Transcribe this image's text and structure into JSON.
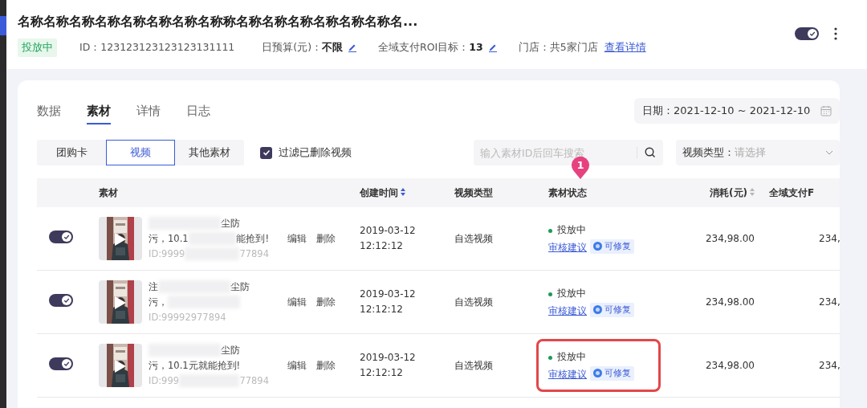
{
  "header": {
    "title": "名称名称名称名称名称名称名称名称称名称名称名称名称名称名称名...",
    "status_badge": "投放中",
    "id_text": "ID：123123123123123131111",
    "budget_label": "日预算(元)：",
    "budget_value": "不限",
    "roi_label": "全域支付ROI目标：",
    "roi_value": "13",
    "store_text": "门店：共5家门店",
    "store_link": "查看详情",
    "enabled": true
  },
  "tabs": [
    {
      "label": "数据",
      "selected": false
    },
    {
      "label": "素材",
      "selected": true
    },
    {
      "label": "详情",
      "selected": false
    },
    {
      "label": "日志",
      "selected": false
    }
  ],
  "date_filter": {
    "label": "日期：",
    "value": "2021-12-10 ~ 2021-12-10"
  },
  "material_types": [
    {
      "label": "团购卡",
      "selected": false
    },
    {
      "label": "视频",
      "selected": true
    },
    {
      "label": "其他素材",
      "selected": false
    }
  ],
  "filter_deleted": {
    "label": "过滤已删除视频",
    "checked": true
  },
  "search": {
    "placeholder": "输入素材ID后回车搜索"
  },
  "video_type_select": {
    "label": "视频类型：",
    "placeholder": "请选择"
  },
  "table": {
    "columns": [
      {
        "label": "素材"
      },
      {
        "label": "创建时间",
        "sorted": true
      },
      {
        "label": "视频类型"
      },
      {
        "label": "素材状态"
      },
      {
        "label": "消耗(元)",
        "sorted": false
      },
      {
        "label": "全域支付F"
      }
    ],
    "rows": [
      {
        "enabled": true,
        "title_lines": [
          [
            {
              "kind": "blur"
            },
            {
              "kind": "text",
              "text": "尘防"
            }
          ],
          [
            {
              "kind": "text",
              "text": "污，10.1"
            },
            {
              "kind": "blur"
            },
            {
              "kind": "text",
              "text": "能抢到!"
            }
          ]
        ],
        "id": [
          {
            "kind": "text",
            "text": "ID:9999"
          },
          {
            "kind": "blur"
          },
          {
            "kind": "text",
            "text": "77894"
          }
        ],
        "actions": [
          "编辑",
          "删除"
        ],
        "created_date": "2019-03-12",
        "created_time": "12:12:12",
        "video_type": "自选视频",
        "status": "投放中",
        "review_link": "审核建议",
        "fix_tag": "可修复",
        "cost": "234,98.00",
        "column_6": "234,",
        "highlighted": false
      },
      {
        "enabled": true,
        "title_lines": [
          [
            {
              "kind": "text",
              "text": "注"
            },
            {
              "kind": "blur"
            },
            {
              "kind": "text",
              "text": "尘防"
            }
          ],
          [
            {
              "kind": "text",
              "text": "污，"
            },
            {
              "kind": "blur"
            }
          ]
        ],
        "id": [
          {
            "kind": "text",
            "text": "ID:99992977894"
          }
        ],
        "actions": [
          "编辑",
          "删除"
        ],
        "created_date": "2019-03-12",
        "created_time": "12:12:12",
        "video_type": "自选视频",
        "status": "投放中",
        "review_link": "审核建议",
        "fix_tag": "可修复",
        "cost": "234,98.00",
        "column_6": "234,",
        "highlighted": false
      },
      {
        "enabled": true,
        "title_lines": [
          [
            {
              "kind": "blur"
            },
            {
              "kind": "text",
              "text": "尘防"
            }
          ],
          [
            {
              "kind": "text",
              "text": "污，10.1元就能抢到!"
            }
          ]
        ],
        "id": [
          {
            "kind": "text",
            "text": "ID:999"
          },
          {
            "kind": "blur"
          },
          {
            "kind": "text",
            "text": "77894"
          }
        ],
        "actions": [
          "编辑",
          "删除"
        ],
        "created_date": "2019-03-12",
        "created_time": "12:12:12",
        "video_type": "自选视频",
        "status": "投放中",
        "review_link": "审核建议",
        "fix_tag": "可修复",
        "cost": "234,98.00",
        "column_6": "234,",
        "highlighted": true
      }
    ]
  },
  "annotation_marker": {
    "label": "1"
  }
}
